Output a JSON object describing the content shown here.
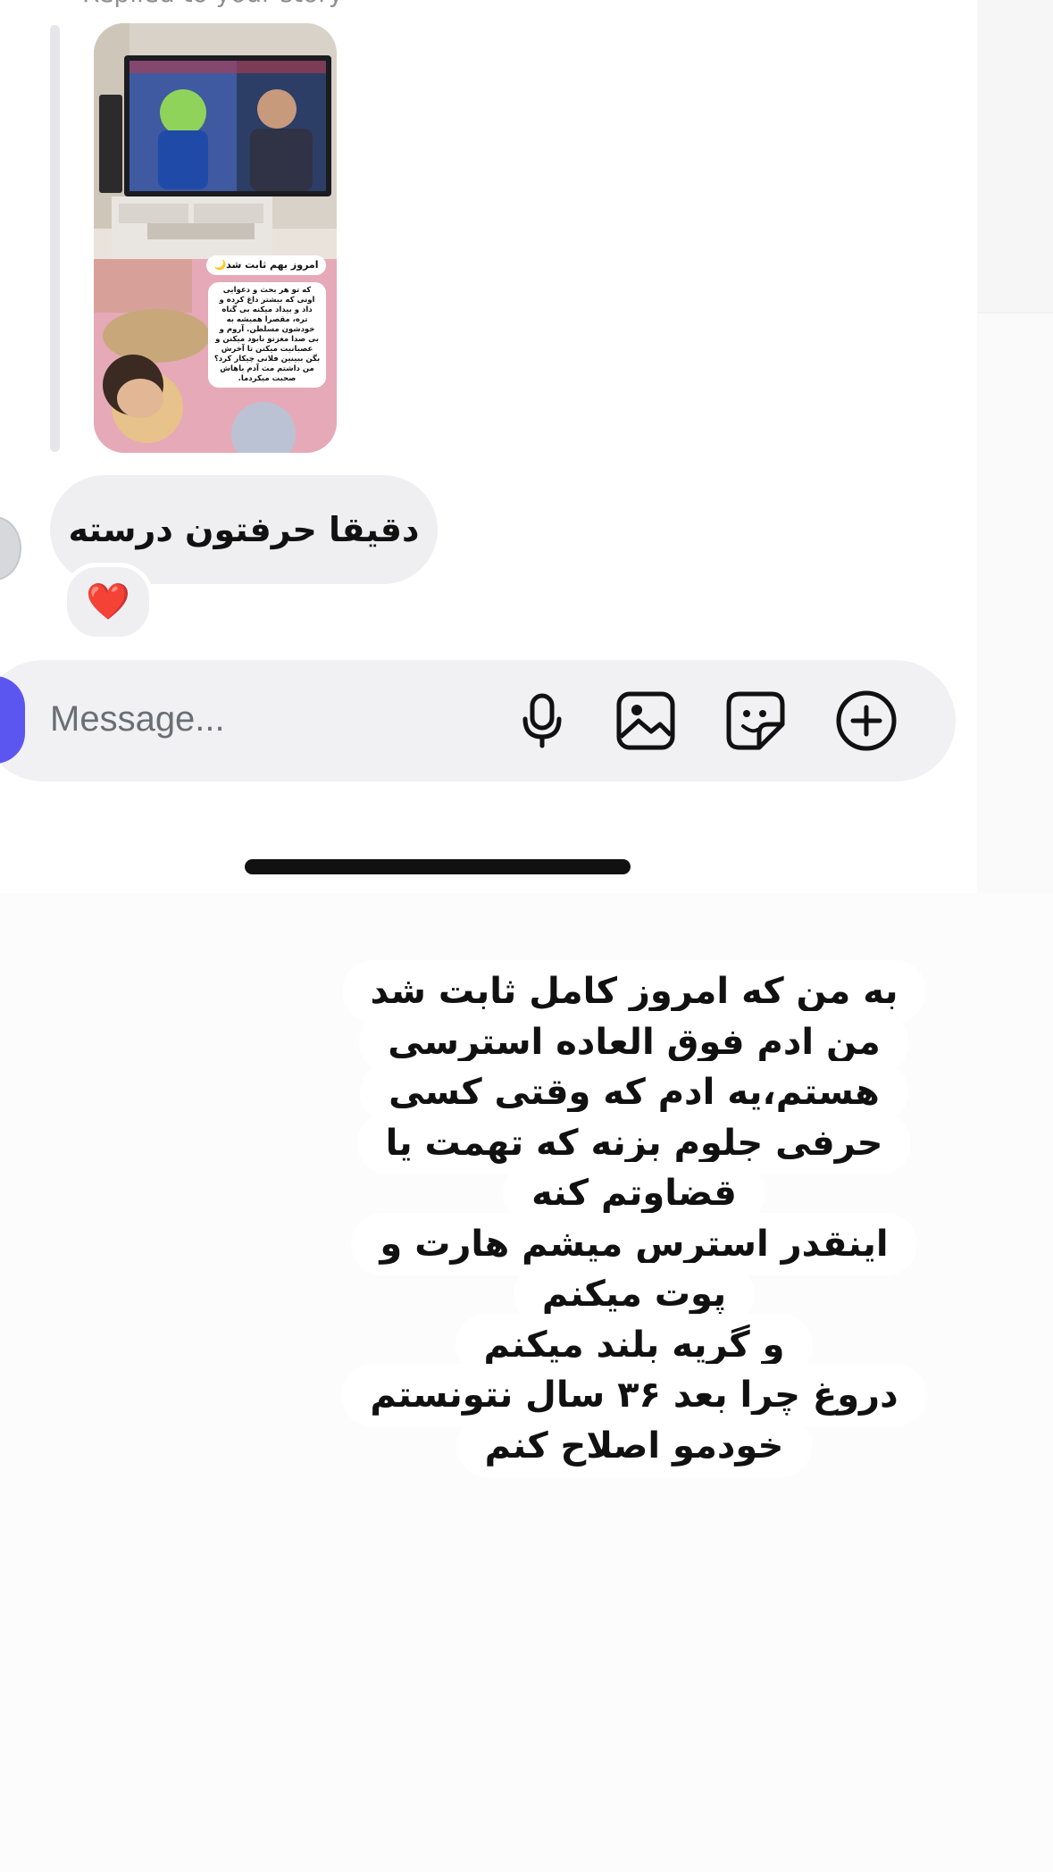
{
  "chat": {
    "replied_label": "Replied to your story",
    "story": {
      "title": "امروز بهم ثابت شد🌙",
      "body": "که تو هر بحث و دعوایی اونی که بیشتر داغ کرده و داد و بیداد میکنه بی گناه تره، مقصرا همیشه به خودشون مسلطن. آروم و بی صدا مغزتو نابود میکنن و عصبانیت میکنن تا آخرش بگن ببینین فلانی چیکار کرد؟ من داشتم مث آدم باهاش صحبت میکردما."
    },
    "received_message": "دقیقا حرفتون درسته",
    "reaction": "❤️",
    "composer": {
      "placeholder": "Message...",
      "icons": [
        "microphone-icon",
        "image-icon",
        "sticker-icon",
        "plus-circle-icon"
      ]
    }
  },
  "caption": {
    "lines": [
      "به من که امروز کامل ثابت شد",
      "من ادم فوق العاده استرسی",
      "هستم،یه ادم که وقتی کسی",
      "حرفی جلوم بزنه  که تهمت یا",
      "قضاوتم کنه",
      "اینقدر استرس میشم هارت و",
      "پوت میکنم",
      "و گریه بلند میکنم",
      "دروغ چرا بعد ۳۶ سال نتونستم",
      "خودمو اصلاح کنم"
    ]
  },
  "colors": {
    "accent": "#5b56f0",
    "bubble": "#efeff2",
    "heart": "#e11d2e"
  }
}
